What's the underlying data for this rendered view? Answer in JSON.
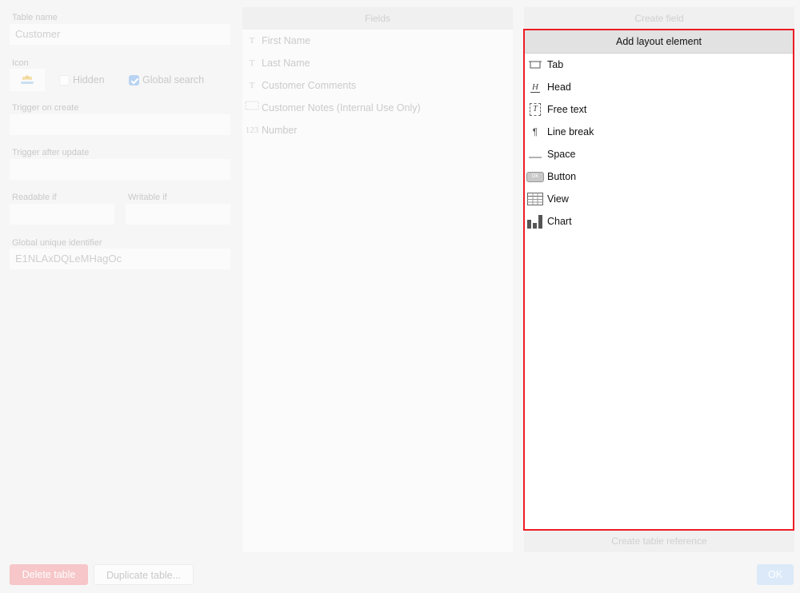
{
  "left": {
    "table_name_label": "Table name",
    "table_name_value": "Customer",
    "icon_label": "Icon",
    "hidden_label": "Hidden",
    "global_search_label": "Global search",
    "trigger_create_label": "Trigger on create",
    "trigger_update_label": "Trigger after update",
    "readable_label": "Readable if",
    "writable_label": "Writable if",
    "guid_label": "Global unique identifier",
    "guid_value": "E1NLAxDQLeMHagOc"
  },
  "fields": {
    "header": "Fields",
    "items": [
      {
        "icon": "T",
        "label": "First Name"
      },
      {
        "icon": "T",
        "label": "Last Name"
      },
      {
        "icon": "T",
        "label": "Customer Comments"
      },
      {
        "icon": "",
        "label": "Customer Notes (Internal Use Only)"
      },
      {
        "icon": "123",
        "label": "Number"
      }
    ]
  },
  "right": {
    "create_field_label": "Create field",
    "create_table_reference_label": "Create table reference"
  },
  "popup": {
    "title": "Add layout element",
    "items": [
      {
        "icon": "tab-icon",
        "label": "Tab"
      },
      {
        "icon": "head-icon",
        "label": "Head"
      },
      {
        "icon": "free-text-icon",
        "label": "Free text"
      },
      {
        "icon": "line-break-icon",
        "label": "Line break"
      },
      {
        "icon": "space-icon",
        "label": "Space"
      },
      {
        "icon": "button-icon",
        "label": "Button"
      },
      {
        "icon": "view-icon",
        "label": "View"
      },
      {
        "icon": "chart-icon",
        "label": "Chart"
      }
    ],
    "button_icon_text": "OK",
    "head_icon_text": "H",
    "free_text_icon_text": "T",
    "line_break_icon_text": "¶"
  },
  "footer": {
    "delete_label": "Delete table",
    "duplicate_label": "Duplicate table...",
    "ok_label": "OK"
  },
  "colors": {
    "highlight_border": "#ee1c25",
    "delete_bg": "#f6c6c8",
    "ok_bg": "#dbe9f8"
  }
}
